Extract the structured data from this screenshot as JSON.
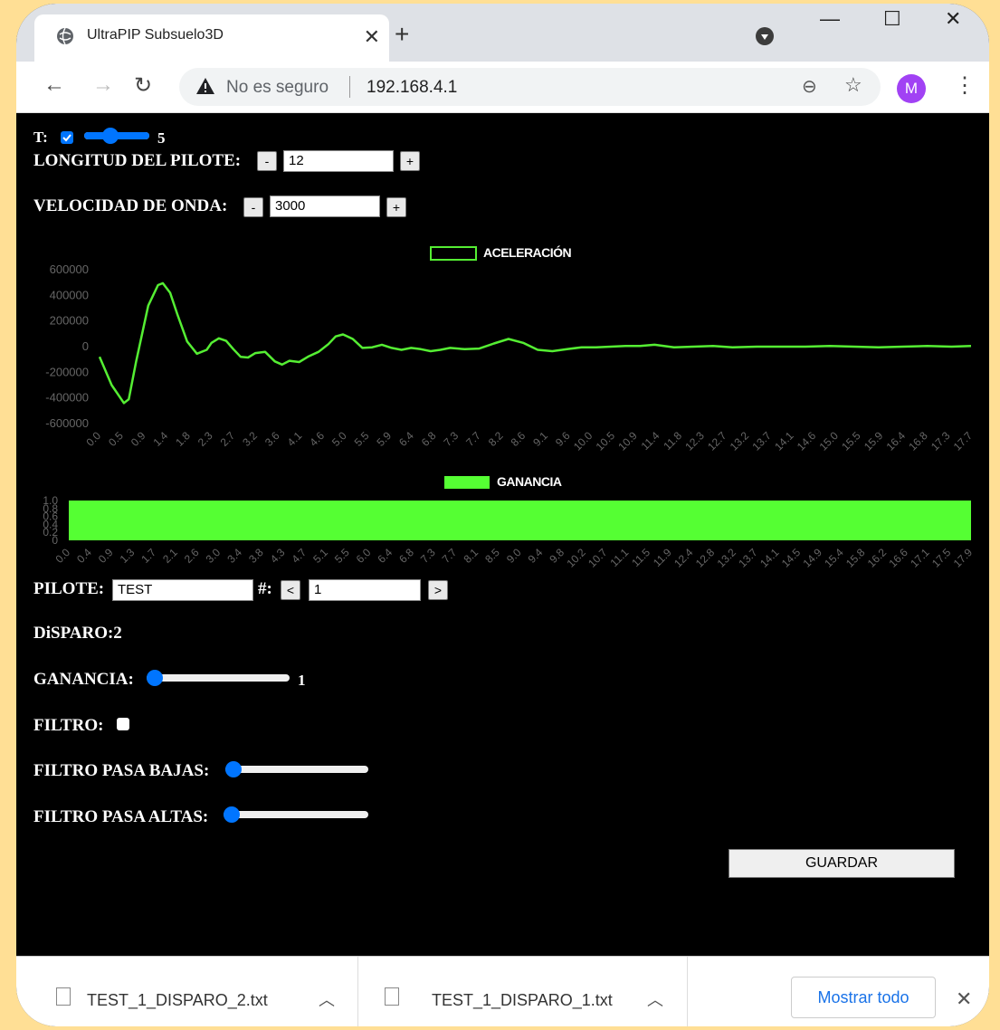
{
  "browser": {
    "tab_title": "UltraPIP Subsuelo3D",
    "address_insecure": "No es seguro",
    "address_url": "192.168.4.1",
    "profile_initial": "M"
  },
  "controls": {
    "t_label": "T:",
    "t_checked": true,
    "t_value": "5",
    "longitud_label": "LONGITUD DEL PILOTE:",
    "longitud_value": "12",
    "velocidad_label": "VELOCIDAD DE ONDA:",
    "velocidad_value": "3000",
    "minus": "-",
    "plus": "+",
    "pilote_label": "PILOTE:",
    "pilote_value": "TEST",
    "num_label": "#:",
    "prev": "<",
    "next": ">",
    "num_value": "1",
    "disparo_label": "DiSPARO:2",
    "ganancia_label": "GANANCIA:",
    "ganancia_value": "1",
    "filtro_label": "FILTRO:",
    "filtro_checked": false,
    "pasa_bajas_label": "FILTRO PASA BAJAS:",
    "pasa_altas_label": "FILTRO PASA ALTAS:",
    "guardar": "GUARDAR"
  },
  "downloads": {
    "items": [
      "TEST_1_DISPARO_2.txt",
      "TEST_1_DISPARO_1.txt"
    ],
    "show_all": "Mostrar todo"
  },
  "chart_data": [
    {
      "type": "line",
      "legend": "ACELERACIÓN",
      "color": "#55ee33",
      "ylim": [
        -600000,
        600000
      ],
      "yticks": [
        "600000",
        "400000",
        "200000",
        "0",
        "-200000",
        "-400000",
        "-600000"
      ],
      "xticks": [
        "0.0",
        "0.5",
        "0.9",
        "1.4",
        "1.8",
        "2.3",
        "2.7",
        "3.2",
        "3.6",
        "4.1",
        "4.6",
        "5.0",
        "5.5",
        "5.9",
        "6.4",
        "6.8",
        "7.3",
        "7.7",
        "8.2",
        "8.6",
        "9.1",
        "9.6",
        "10.0",
        "10.5",
        "10.9",
        "11.4",
        "11.8",
        "12.3",
        "12.7",
        "13.2",
        "13.7",
        "14.1",
        "14.6",
        "15.0",
        "15.5",
        "15.9",
        "16.4",
        "16.8",
        "17.3",
        "17.7"
      ],
      "x": [
        0.0,
        0.25,
        0.5,
        0.6,
        0.75,
        1.0,
        1.2,
        1.3,
        1.45,
        1.6,
        1.8,
        2.0,
        2.2,
        2.3,
        2.45,
        2.6,
        2.75,
        2.9,
        3.05,
        3.2,
        3.4,
        3.6,
        3.75,
        3.9,
        4.1,
        4.3,
        4.5,
        4.7,
        4.85,
        5.0,
        5.2,
        5.4,
        5.6,
        5.8,
        6.0,
        6.2,
        6.4,
        6.6,
        6.8,
        7.0,
        7.2,
        7.5,
        7.8,
        8.1,
        8.4,
        8.7,
        9.0,
        9.3,
        9.6,
        9.9,
        10.2,
        10.5,
        10.8,
        11.1,
        11.4,
        11.8,
        12.2,
        12.6,
        13.0,
        13.5,
        14.0,
        14.5,
        15.0,
        15.5,
        16.0,
        16.5,
        17.0,
        17.5,
        17.9
      ],
      "y": [
        -80000,
        -300000,
        -440000,
        -410000,
        -120000,
        320000,
        480000,
        495000,
        420000,
        250000,
        40000,
        -55000,
        -25000,
        30000,
        65000,
        45000,
        -20000,
        -80000,
        -85000,
        -50000,
        -40000,
        -115000,
        -140000,
        -110000,
        -120000,
        -75000,
        -40000,
        20000,
        80000,
        95000,
        60000,
        -10000,
        -5000,
        15000,
        -10000,
        -25000,
        -10000,
        -20000,
        -35000,
        -25000,
        -10000,
        -20000,
        -15000,
        25000,
        60000,
        30000,
        -25000,
        -35000,
        -20000,
        -5000,
        -5000,
        0,
        5000,
        5000,
        15000,
        -5000,
        0,
        5000,
        -5000,
        0,
        0,
        0,
        5000,
        0,
        -5000,
        0,
        5000,
        0,
        5000
      ]
    },
    {
      "type": "bar",
      "legend": "GANANCIA",
      "color": "#55ff33",
      "ylim": [
        0,
        1.0
      ],
      "yticks": [
        "1.0",
        "0.8",
        "0.6",
        "0.4",
        "0.2",
        "0"
      ],
      "xticks": [
        "0.0",
        "0.4",
        "0.9",
        "1.3",
        "1.7",
        "2.1",
        "2.6",
        "3.0",
        "3.4",
        "3.8",
        "4.3",
        "4.7",
        "5.1",
        "5.5",
        "6.0",
        "6.4",
        "6.8",
        "7.3",
        "7.7",
        "8.1",
        "8.5",
        "9.0",
        "9.4",
        "9.8",
        "10.2",
        "10.7",
        "11.1",
        "11.5",
        "11.9",
        "12.4",
        "12.8",
        "13.2",
        "13.7",
        "14.1",
        "14.5",
        "14.9",
        "15.4",
        "15.8",
        "16.2",
        "16.6",
        "17.1",
        "17.5",
        "17.9"
      ],
      "value": 1.0
    }
  ]
}
